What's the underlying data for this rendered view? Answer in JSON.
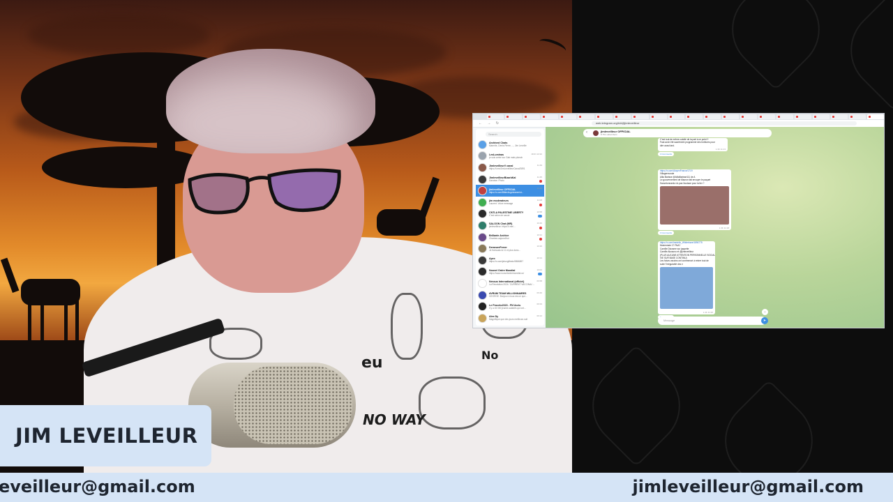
{
  "overlay": {
    "presenter_name": "JIM LEVEILLEUR",
    "email_left": "eveilleur@gmail.com",
    "email_right": "jimleveilleur@gmail.com"
  },
  "browser": {
    "url": "web.telegram.org/k/#@jimleveilleur",
    "tabs_count": 22
  },
  "telegram": {
    "search_placeholder": "Search",
    "chats": [
      {
        "name": "Archived Chats",
        "preview": "Marmite, Denis Pierre, ..., Jim Leveille",
        "time": "",
        "color": "#5aa0e6",
        "badge": ""
      },
      {
        "name": "LesLuminas",
        "preview": "je suis arrivé sur Gab mais pfanch",
        "time": "MON 10:32",
        "color": "#9aa3ad",
        "badge": ""
      },
      {
        "name": "JimleveilleurV canal",
        "preview": "https://t.me/JimLeveilleurCanal/2891",
        "time": "11:49",
        "color": "#8a5a4a",
        "badge": ""
      },
      {
        "name": "JimleveilleurBizarbKal",
        "preview": "Danoise: Photo",
        "time": "11:45",
        "color": "#3a3a3a",
        "badge": "red"
      },
      {
        "name": "jimleveilleur OFFICIAL",
        "preview": "https://x.com/BitterAngelowner/st...",
        "time": "11:26",
        "color": "#c04040",
        "badge": "blue"
      },
      {
        "name": "jim moderateurs",
        "preview": "Laurent: Voice message",
        "time": "11:08",
        "color": "#3fae50",
        "badge": "red"
      },
      {
        "name": "CNTLA PALESTINE LIBERTY",
        "preview": "C'est selon de savoir",
        "time": "10:58",
        "color": "#2a2a2a",
        "badge": "blue"
      },
      {
        "name": "SALOON Chat (MR)",
        "preview": "jimleveilleur: https://t.me/...",
        "time": "10:40",
        "color": "#2e7d6a",
        "badge": "red"
      },
      {
        "name": "Brillante Archive",
        "preview": "Chartres aujourd'hui",
        "time": "10:31",
        "color": "#6a4a8a",
        "badge": "red"
      },
      {
        "name": "DemeureFerrer",
        "preview": "Je florissais là 11 et plus dans...",
        "time": "10:20",
        "color": "#8a7a5a",
        "badge": ""
      },
      {
        "name": "Apex",
        "preview": "https://x.com/jetunglifestv/9886897",
        "time": "10:14",
        "color": "#3a3a3a",
        "badge": ""
      },
      {
        "name": "Nouvel Ordre Mondial",
        "preview": "https://www.nouvelordremondial.cc/",
        "time": "10:02",
        "color": "#2a2a2a",
        "badge": "blue"
      },
      {
        "name": "Nessus International (officiel)",
        "preview": "La Revolution 2024: 'CURRENT VACCINAL'...",
        "time": "09:58",
        "color": "#ffffff",
        "badge": ""
      },
      {
        "name": "AVRUM TEAM MILLIONNAIRES",
        "preview": "GEORGE: Bonjour à tous est-ce que...",
        "time": "09:40",
        "color": "#3a4ab0",
        "badge": ""
      },
      {
        "name": "Le Proceto2023 - FN Ucclu",
        "preview": "Il y a 15 000 jeunes salariés qui ont...",
        "time": "09:33",
        "color": "#222222",
        "badge": ""
      },
      {
        "name": "Alex Dy",
        "preview": "Magnifique que des jours meilleurs soit",
        "time": "09:12",
        "color": "#c9a45a",
        "badge": ""
      }
    ],
    "conversation": {
      "title": "jimleveilleur OFFICIAL",
      "subtitle": "8 751 subscribers",
      "messages": [
        {
          "lines": [
            "C'est tout de même culotté de la part à ce point !!",
            "Faut avoir été sacrément programmé des fonfiures pour",
            "dire aussi tard."
          ],
          "meta": "1.3K 11:13"
        },
        {
          "lines": [
            "https://x.com/AloyenFrance/1719",
            "Villagermonde",
            "Alila Barisse @AlilaBarisse111 de A",
            "Le gouvernement de Macron fait envoyer le paquet",
            "Sauvetonnants n'a pas l'audace pour la lier ?"
          ],
          "meta": "1.3K 11:18"
        },
        {
          "lines": [
            "https://x.com/Iraniello_Whiterbare/1896775",
            "Moderniste 17 FNA?",
            "Camille Dicosme sur jaquette",
            "Camille Akosono et @jimleveilleur",
            "(PLUS AUCUNE ATTENTION PERSONNELLE SOCIALE TENTANTE",
            "VIE SUR BASE CONTINU)",
            "Les futurs vaccins ont commencé à entrer tout de",
            "suite l'Irrégularité des e"
          ],
          "meta": "1.3K 11:26"
        }
      ],
      "replies_label": "3 Comments",
      "input_placeholder": "Message"
    }
  },
  "colors": {
    "overlay_bg": "#d5e4f6",
    "overlay_text": "#1e2530",
    "telegram_blue": "#3d8fe3"
  }
}
